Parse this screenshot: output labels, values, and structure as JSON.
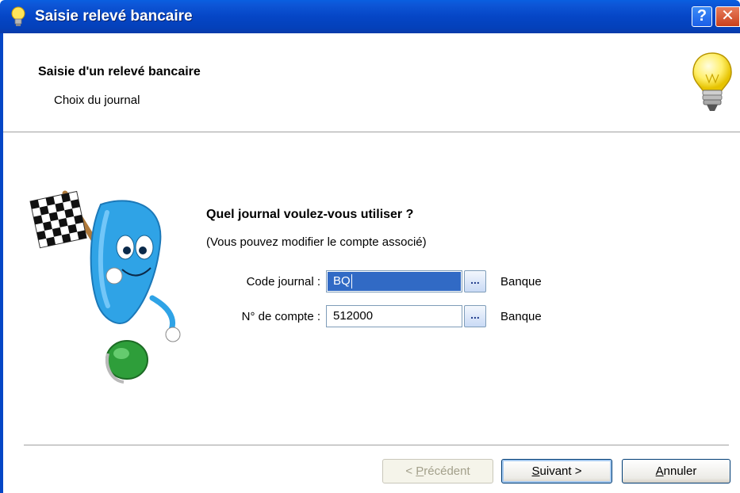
{
  "window": {
    "title": "Saisie relevé bancaire",
    "help_label": "?",
    "close_label": "✕"
  },
  "header": {
    "title": "Saisie d'un relevé bancaire",
    "subtitle": "Choix du journal"
  },
  "main": {
    "question": "Quel journal voulez-vous utiliser ?",
    "hint": "(Vous pouvez modifier le compte associé)",
    "fields": [
      {
        "label": "Code journal :",
        "value": "BQ",
        "button": "...",
        "description": "Banque"
      },
      {
        "label": "N° de compte :",
        "value": "512000",
        "button": "...",
        "description": "Banque"
      }
    ]
  },
  "footer": {
    "prev_prefix": "< ",
    "prev_accel": "P",
    "prev_rest": "récédent",
    "next_accel": "S",
    "next_rest": "uivant >",
    "cancel_accel": "A",
    "cancel_rest": "nnuler"
  },
  "colors": {
    "titlebar": "#0546c6",
    "selection": "#316ac5"
  }
}
